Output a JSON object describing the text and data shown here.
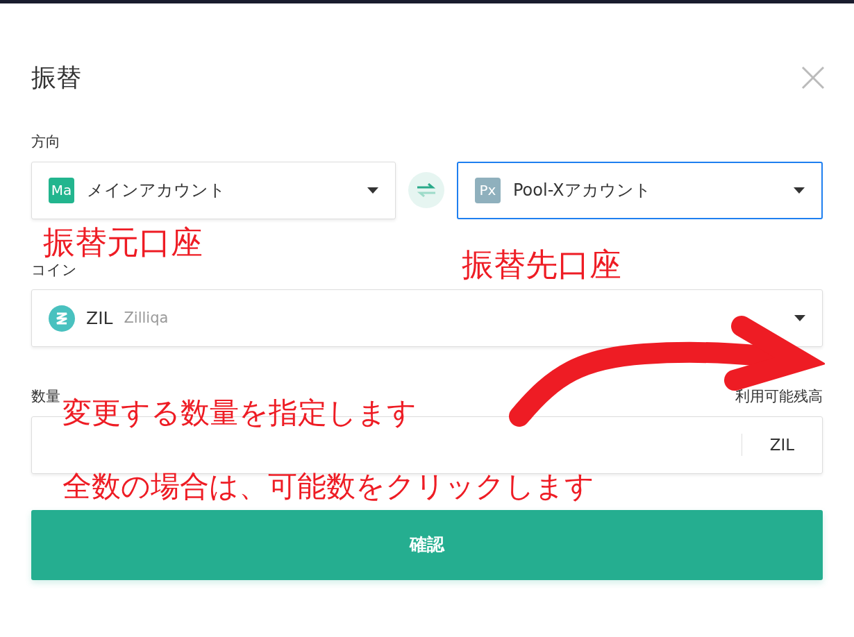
{
  "dialog": {
    "title": "振替",
    "direction_label": "方向",
    "accounts": [
      {
        "badge": "Ma",
        "color": "#22b58e",
        "name": "メインアカウント",
        "focused": false
      },
      {
        "badge": "Px",
        "color": "#8fb0bd",
        "name": "Pool-Xアカウント",
        "focused": true
      }
    ],
    "coin_label": "コイン",
    "coin": {
      "symbol": "ZIL",
      "name": "Zilliqa"
    },
    "amount_label": "数量",
    "available_label": "利用可能残高",
    "amount_unit": "ZIL",
    "confirm_button": "確認"
  },
  "annotations": [
    {
      "text": "振替元口座",
      "kind": "from"
    },
    {
      "text": "振替先口座",
      "kind": "to"
    },
    {
      "text": "変更する数量を指定します",
      "kind": "amount"
    },
    {
      "text": "全数の場合は、可能数をクリックします",
      "kind": "all"
    }
  ]
}
